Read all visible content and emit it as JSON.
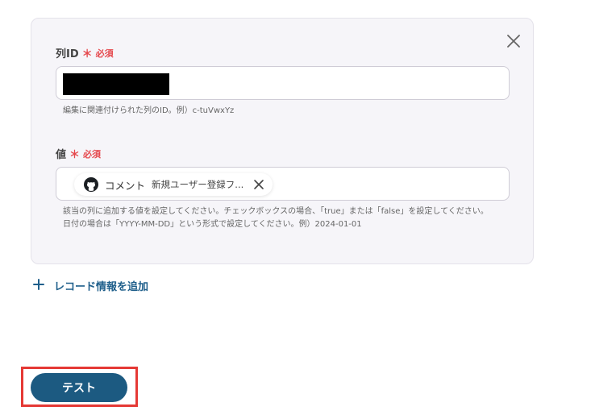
{
  "form": {
    "column_id": {
      "label": "列ID",
      "required_star": "＊",
      "required_text": "必須",
      "help": "編集に関連付けられた列のID。例）c-tuVwxYz"
    },
    "value": {
      "label": "値",
      "required_star": "＊",
      "required_text": "必須",
      "chip_name": "コメント",
      "chip_value": "新規ユーザー登録フ...",
      "help_line1": "該当の列に追加する値を設定してください。チェックボックスの場合、「true」または「false」を設定してください。",
      "help_line2": "日付の場合は「YYYY-MM-DD」という形式で設定してください。例）2024-01-01"
    }
  },
  "actions": {
    "add_record": "レコード情報を追加",
    "test": "テスト"
  },
  "icons": {
    "close": "close-icon",
    "github": "github-icon",
    "chip_remove": "close-icon",
    "plus": "plus-icon"
  },
  "colors": {
    "card_bg": "#f6f5f9",
    "required": "#e5484d",
    "link": "#1f5f8b",
    "primary_button": "#1c5a81",
    "highlight": "#e53935"
  }
}
